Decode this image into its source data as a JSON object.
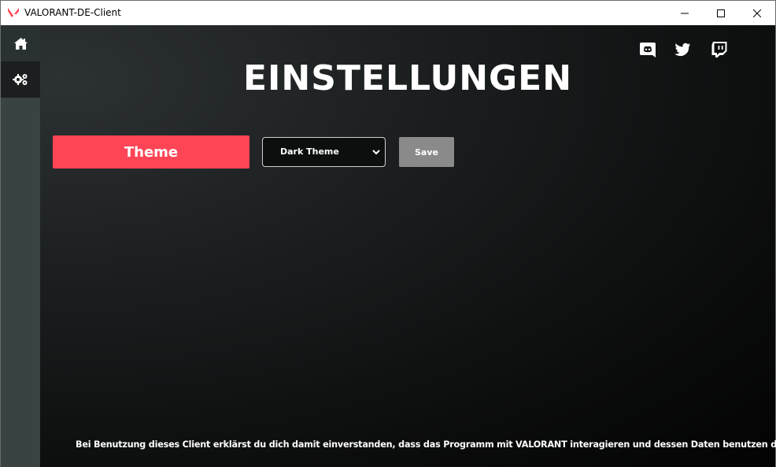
{
  "window": {
    "title": "VALORANT-DE-Client",
    "brand_color": "#fd4556"
  },
  "titlebar": {
    "icons": [
      "valorant-logo-icon",
      "minimize-icon",
      "maximize-icon",
      "close-icon"
    ]
  },
  "sidebar": {
    "items": [
      {
        "name": "home",
        "icon": "home-icon"
      },
      {
        "name": "settings",
        "icon": "gears-icon",
        "active": true
      }
    ]
  },
  "social": {
    "icons": [
      "discord-icon",
      "twitter-icon",
      "twitch-icon"
    ]
  },
  "main": {
    "title": "EINSTELLUNGEN",
    "theme_label": "Theme",
    "theme_select_value": "Dark Theme",
    "save_label": "Save",
    "disclaimer": "Bei Benutzung dieses Client erklärst du dich damit einverstanden, dass das Programm mit VALORANT interagieren und dessen Daten benutzen darf"
  },
  "colors": {
    "accent": "#fd4556",
    "save_button": "#8a8a8a",
    "sidebar": "#394442"
  }
}
